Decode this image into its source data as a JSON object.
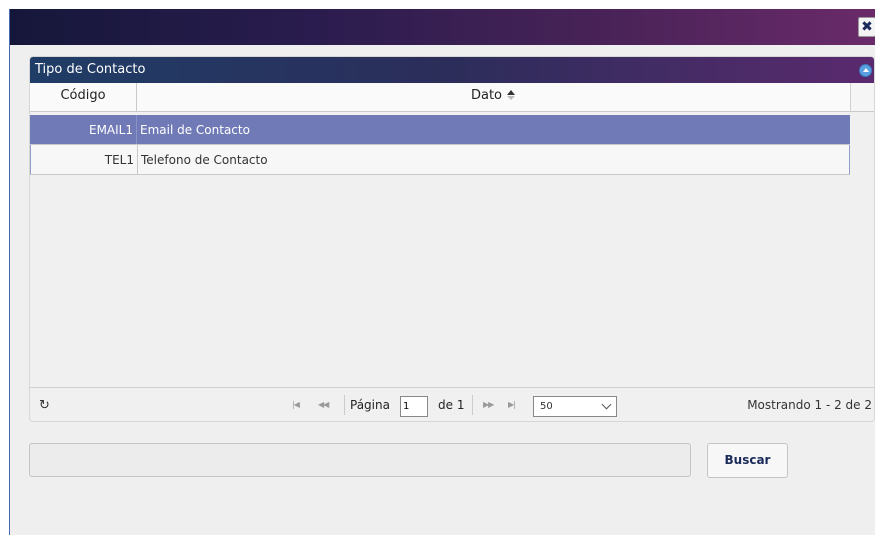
{
  "dialog": {
    "close_icon": "close-icon",
    "close_label": "✖"
  },
  "grid": {
    "caption": "Tipo de Contacto",
    "columns": [
      {
        "label": "Código"
      },
      {
        "label": "Dato",
        "sort": "ascending"
      }
    ],
    "rows": [
      {
        "codigo": "EMAIL1",
        "dato": "Email de Contacto",
        "selected": true
      },
      {
        "codigo": "TEL1",
        "dato": "Telefono de Contacto",
        "selected": false
      }
    ],
    "colors": {
      "selected_row": "#6f7ab7",
      "caption_start": "#1f3d66",
      "caption_end": "#5a2a6e"
    }
  },
  "pager": {
    "refresh_icon": "refresh-icon",
    "page_label": "Página",
    "page_value": "1",
    "of_label": "de 1",
    "page_size": "50",
    "info": "Mostrando 1 - 2 de 2"
  },
  "search": {
    "value": "",
    "button_label": "Buscar"
  }
}
